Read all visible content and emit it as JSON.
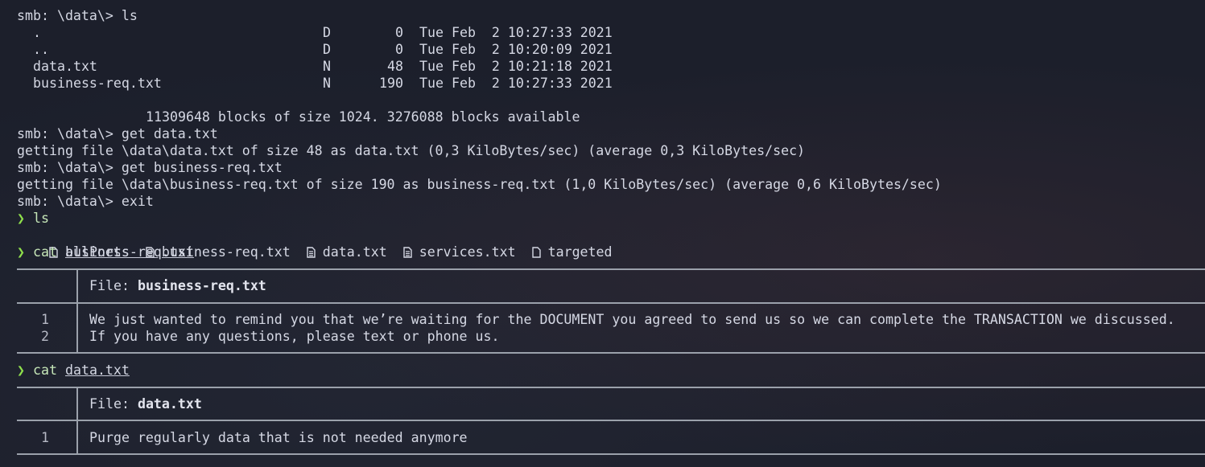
{
  "smb": {
    "prompt": "smb: \\data\\> ",
    "ls_cmd": "ls",
    "entries": [
      {
        "name": ".",
        "type": "D",
        "size": "0",
        "date": "Tue Feb  2 10:27:33 2021"
      },
      {
        "name": "..",
        "type": "D",
        "size": "0",
        "date": "Tue Feb  2 10:20:09 2021"
      },
      {
        "name": "data.txt",
        "type": "N",
        "size": "48",
        "date": "Tue Feb  2 10:21:18 2021"
      },
      {
        "name": "business-req.txt",
        "type": "N",
        "size": "190",
        "date": "Tue Feb  2 10:27:33 2021"
      }
    ],
    "blocks_line": "11309648 blocks of size 1024. 3276088 blocks available",
    "get1_cmd": "get data.txt",
    "get1_out": "getting file \\data\\data.txt of size 48 as data.txt (0,3 KiloBytes/sec) (average 0,3 KiloBytes/sec)",
    "get2_cmd": "get business-req.txt",
    "get2_out": "getting file \\data\\business-req.txt of size 190 as business-req.txt (1,0 KiloBytes/sec) (average 0,6 KiloBytes/sec)",
    "exit_cmd": "exit"
  },
  "shell": {
    "prompt_symbol": "❯",
    "ls_cmd": "ls",
    "ls_items": [
      "allPorts",
      "business-req.txt",
      "data.txt",
      "services.txt",
      "targeted"
    ],
    "ls_icons": [
      "file-outline-icon",
      "file-text-icon",
      "file-text-icon",
      "file-text-icon",
      "file-outline-icon"
    ],
    "cat1_cmd": "cat",
    "cat1_arg": "business-req.txt",
    "cat2_cmd": "cat",
    "cat2_arg": "data.txt"
  },
  "bat1": {
    "header_label": "File: ",
    "filename": "business-req.txt",
    "lines": [
      {
        "num": "1",
        "text": "We just wanted to remind you that we’re waiting for the DOCUMENT you agreed to send us so we can complete the TRANSACTION we discussed."
      },
      {
        "num": "2",
        "text": "If you have any questions, please text or phone us."
      }
    ]
  },
  "bat2": {
    "header_label": "File: ",
    "filename": "data.txt",
    "lines": [
      {
        "num": "1",
        "text": "Purge regularly data that is not needed anymore"
      }
    ]
  },
  "colors": {
    "background": "#1c1f2b",
    "text": "#d5d8e4",
    "prompt_arrow": "#8fe04c",
    "rule": "#9ba1ab"
  }
}
